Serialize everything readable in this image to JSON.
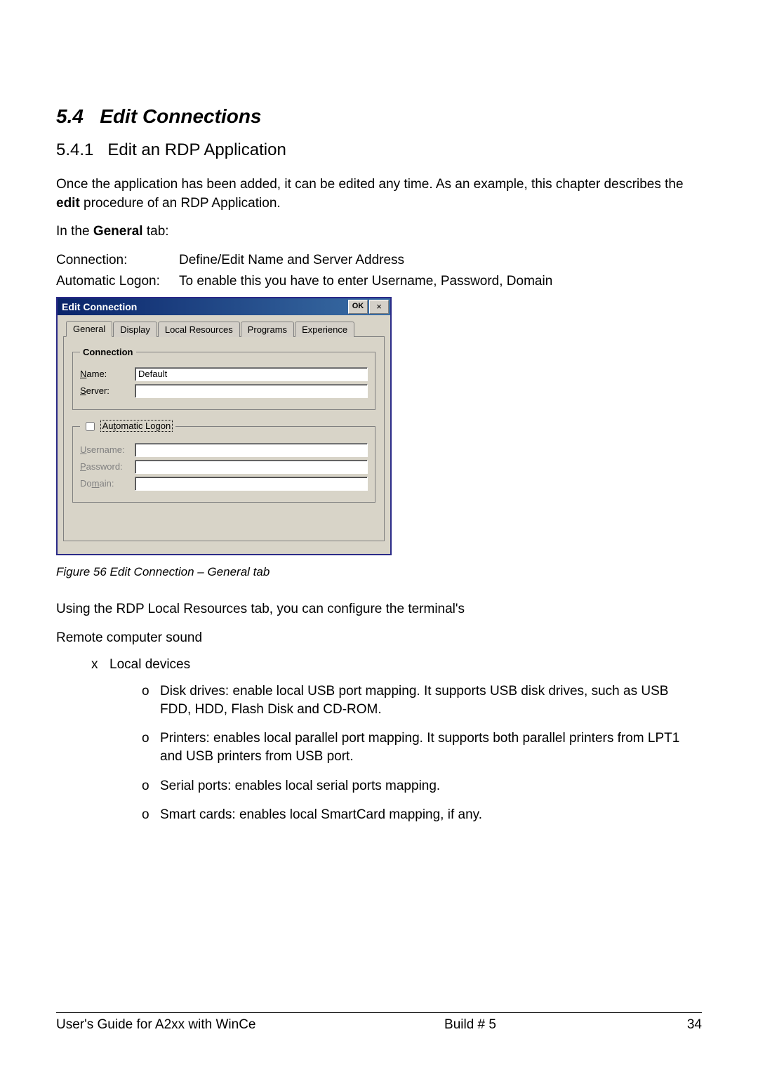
{
  "section": {
    "number": "5.4",
    "title": "Edit Connections"
  },
  "subsection": {
    "number": "5.4.1",
    "title": "Edit an RDP Application"
  },
  "paragraphs": {
    "intro1": "Once the application has been added, it can be edited any time. As an example, this chapter describes the ",
    "intro_bold": "edit",
    "intro2": " procedure of an RDP Application.",
    "inthe_prefix": "In the ",
    "inthe_bold": "General",
    "inthe_suffix": " tab:"
  },
  "defs": {
    "connection_label": "Connection:",
    "connection_value": "Define/Edit Name and Server Address",
    "autologon_label": "Automatic Logon:",
    "autologon_value": "To enable this you have to enter Username, Password, Domain"
  },
  "dialog": {
    "title": "Edit Connection",
    "ok": "OK",
    "close_glyph": "×",
    "tabs": [
      "General",
      "Display",
      "Local Resources",
      "Programs",
      "Experience"
    ],
    "group_connection": {
      "legend": "Connection",
      "name_prefix": "N",
      "name_rest": "ame:",
      "name_value": "Default",
      "server_prefix": "S",
      "server_rest": "erver:",
      "server_value": ""
    },
    "group_autologon": {
      "label_prefix": "Au",
      "label_u": "t",
      "label_rest": "omatic Logon",
      "username_prefix": "U",
      "username_rest": "sername:",
      "password_prefix": "P",
      "password_rest": "assword:",
      "domain_prefix": "Do",
      "domain_u": "m",
      "domain_rest": "ain:"
    }
  },
  "figure_caption": "Figure 56 Edit Connection – General tab",
  "post_dialog_para": "Using the RDP Local Resources tab, you can configure the terminal's",
  "remote_sound": "Remote computer sound",
  "list": {
    "lvl1_glyph": "x",
    "lvl2_glyph": "o",
    "item1": "Local devices",
    "sub1": "Disk drives: enable local USB port mapping. It supports USB disk drives, such as USB FDD, HDD, Flash Disk and CD-ROM.",
    "sub2": "Printers: enables local parallel port mapping. It supports both parallel printers from LPT1 and USB printers from USB port.",
    "sub3": "Serial ports: enables local serial ports mapping.",
    "sub4": "Smart cards: enables local SmartCard mapping, if any."
  },
  "footer": {
    "left": "User's Guide for A2xx with WinCe",
    "center": "Build # 5",
    "page": "34"
  }
}
